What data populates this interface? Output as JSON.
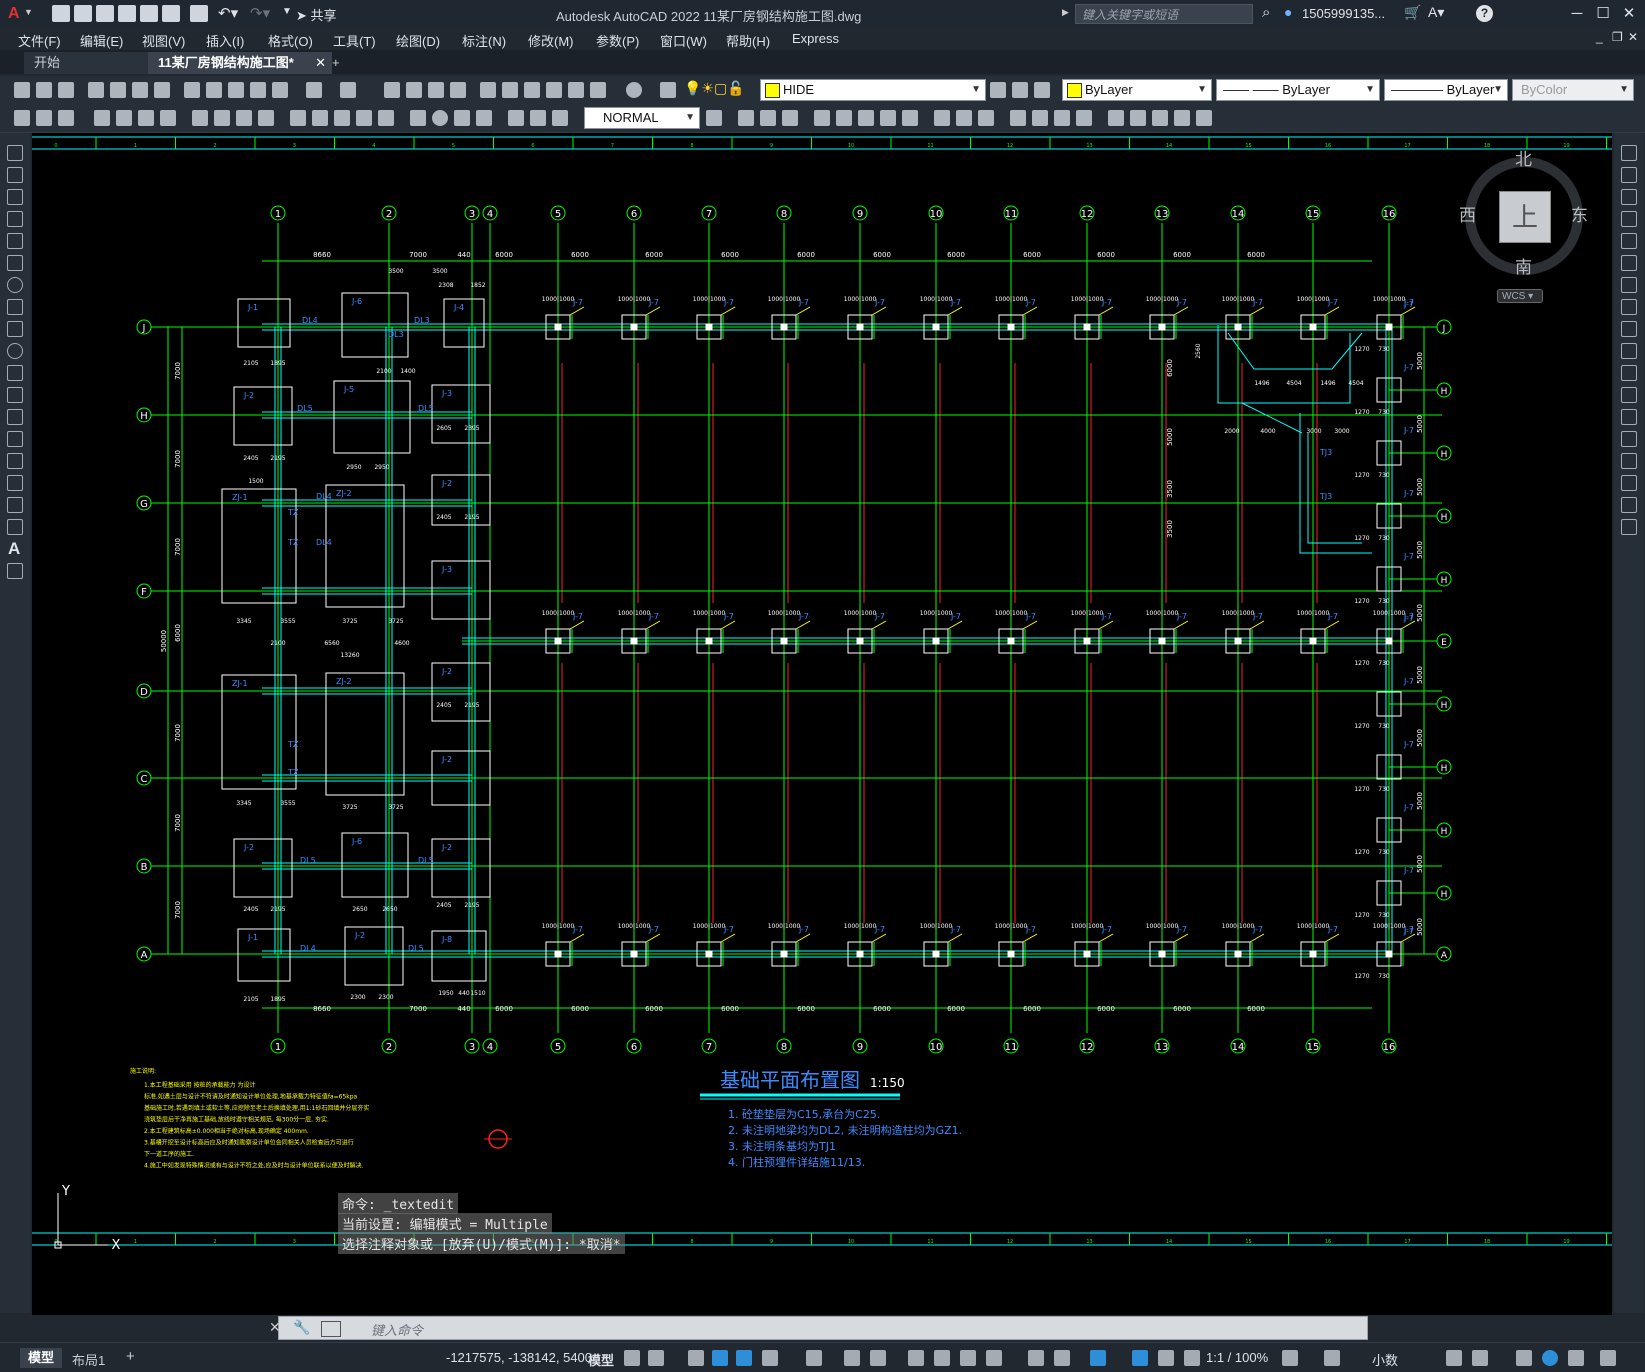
{
  "app": {
    "title": "Autodesk AutoCAD 2022    11某厂房钢结构施工图.dwg",
    "share_label": "共享",
    "search_placeholder": "键入关键字或短语",
    "user": "1505999135...",
    "help": "?"
  },
  "menu": [
    "文件(F)",
    "编辑(E)",
    "视图(V)",
    "插入(I)",
    "格式(O)",
    "工具(T)",
    "绘图(D)",
    "标注(N)",
    "修改(M)",
    "参数(P)",
    "窗口(W)",
    "帮助(H)",
    "Express"
  ],
  "tabs": {
    "start": "开始",
    "active": "11某厂房钢结构施工图*",
    "add": "+"
  },
  "toolbar": {
    "layer": "HIDE",
    "color": "ByLayer",
    "linetype": "—— —— ByLayer",
    "lineweight": "———— ByLayer",
    "plotstyle": "ByColor",
    "dimstyle": "NORMAL"
  },
  "viewcube": {
    "north": "北",
    "south": "南",
    "east": "东",
    "west": "西",
    "top": "上",
    "wcs": "WCS"
  },
  "drawing": {
    "title": "基础平面布置图",
    "scale": "1:150",
    "notes_right": [
      "1. 砼垫垫层为C15,承台为C25.",
      "2. 未注明地梁均为DL2, 未注明构造柱均为GZ1.",
      "3. 未注明条基均为TJ1",
      "4. 门柱预埋件详结施11/13."
    ],
    "notes_left_title": "施工说明:",
    "notes_left": [
      "1.本工程基础采用              按桩的承载能力                     为设计",
      "  标准,如遇土层与设计不符请及时通知设计单位处理,地基承载力特征值fa=65kpa",
      "  基础施工时,若遇到填土或软土等,应挖除至老土后换填处理,用1:1砂石回填并分层夯实",
      "  浇筑垫层后干净再施工基础,放线时遵守相关规范, 每300分一层, 夯实.",
      "2.本工程建筑标高±0.000相当于绝对标高,现场确定 400mm.",
      "3.基槽开挖至设计标高后应及时通知勘察设计单位会同相关人员检查后方可进行",
      "  下一道工序的施工.",
      "4.施工中如发现特殊情况或有与设计不符之处,应及时与设计单位联系以便及时解决."
    ],
    "col_axes": [
      "1",
      "2",
      "3",
      "4",
      "5",
      "6",
      "7",
      "8",
      "9",
      "10",
      "11",
      "12",
      "13",
      "14",
      "15",
      "16"
    ],
    "row_axes_left": [
      "J",
      "H",
      "G",
      "F",
      "E",
      "D",
      "C",
      "B",
      "A"
    ],
    "row_axes_right": [
      "J",
      "H",
      "H",
      "H",
      "H",
      "E",
      "H",
      "H",
      "H",
      "H",
      "H",
      "A"
    ],
    "top_dims": [
      "8660",
      "7000",
      "440",
      "6000",
      "6000",
      "6000",
      "6000",
      "6000",
      "6000",
      "6000",
      "6000",
      "6000",
      "6000",
      "6000"
    ],
    "overall_dim": "50000",
    "left_dims": [
      "7000",
      "7000",
      "7000",
      "6000",
      "7000",
      "7000",
      "7000"
    ],
    "footing_label": "J-7",
    "footing_dim": "1000|1000",
    "labels_left": {
      "j1": "J-1",
      "j2": "J-2",
      "j3": "J-3",
      "j4": "J-4",
      "j5": "J-5",
      "j6": "J-6",
      "j8": "J-8",
      "zj1": "ZJ-1",
      "zj2": "ZJ-2",
      "dl3": "DL3",
      "dl4": "DL4",
      "dl5": "DL5",
      "tz": "TZ",
      "tj3": "TJ3"
    },
    "dim_texts": [
      "2105",
      "1895",
      "2100",
      "1400",
      "2950",
      "2405",
      "2195",
      "2605",
      "2395",
      "3345",
      "3555",
      "3725",
      "1500",
      "6560",
      "4600",
      "13260",
      "2650",
      "2300",
      "1950",
      "440",
      "1510",
      "2100",
      "2308",
      "1852",
      "1270",
      "730",
      "1496",
      "4504",
      "2000",
      "4000",
      "3000",
      "5000",
      "2560",
      "3500",
      "6000"
    ]
  },
  "command": {
    "line1": "命令: _textedit",
    "line2": "当前设置: 编辑模式 = Multiple",
    "line3": "选择注释对象或 [放弃(U)/模式(M)]: *取消*",
    "placeholder": "键入命令"
  },
  "status": {
    "model_tab": "模型",
    "layout_tab": "布局1",
    "coords": "-1217575, -138142, 5400",
    "model_btn": "模型",
    "scale": "1:1 / 100%",
    "units": "小数"
  },
  "ucs": {
    "y": "Y",
    "x": "X"
  },
  "colors": {
    "grid": "#00ff00",
    "accent": "#00ffff",
    "red": "#ff2020",
    "text": "#ffff00",
    "blue": "#3d8bff"
  }
}
